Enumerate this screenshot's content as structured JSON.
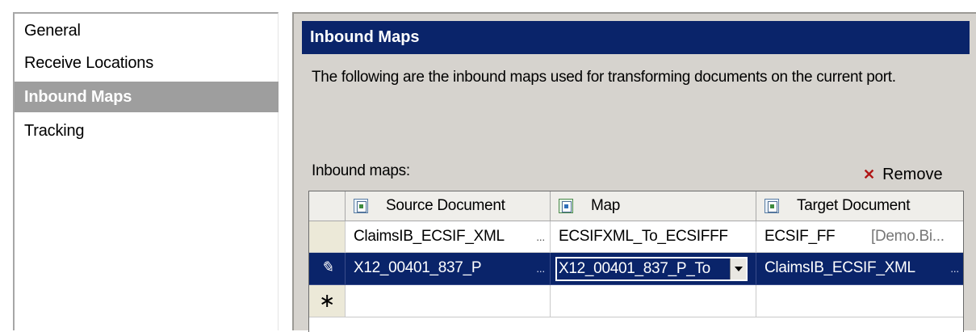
{
  "nav": {
    "items": [
      {
        "label": "General",
        "selected": false
      },
      {
        "label": "Receive Locations",
        "selected": false
      },
      {
        "label": "Inbound Maps",
        "selected": true
      },
      {
        "label": "Tracking",
        "selected": false
      }
    ]
  },
  "panel": {
    "title": "Inbound Maps",
    "description": "The following are the inbound maps used for transforming documents on the current port.",
    "maps_label": "Inbound maps:",
    "remove_label": "Remove",
    "remove_icon": "red-x-icon"
  },
  "grid": {
    "columns": [
      {
        "label": "Source Document",
        "icon": "document-schema-icon"
      },
      {
        "label": "Map",
        "icon": "map-icon"
      },
      {
        "label": "Target Document",
        "icon": "document-schema-icon"
      }
    ],
    "rows": [
      {
        "source": "ClaimsIB_ECSIF_XML",
        "map": "ECSIFXML_To_ECSIFFF",
        "target": "ECSIF_FF",
        "target_extra": "[Demo.Bi..."
      },
      {
        "source": "X12_00401_837_P",
        "map": "X12_00401_837_P_To",
        "target": "ClaimsIB_ECSIF_XML",
        "selected": true,
        "row_icon": "pencil-icon"
      }
    ],
    "new_row_marker": "∗",
    "ellipsis": "..."
  },
  "colors": {
    "header_bg": "#0a246a",
    "selection_bg": "#0a246a",
    "panel_bg": "#d6d3ce",
    "nav_selected_bg": "#9e9e9e"
  }
}
